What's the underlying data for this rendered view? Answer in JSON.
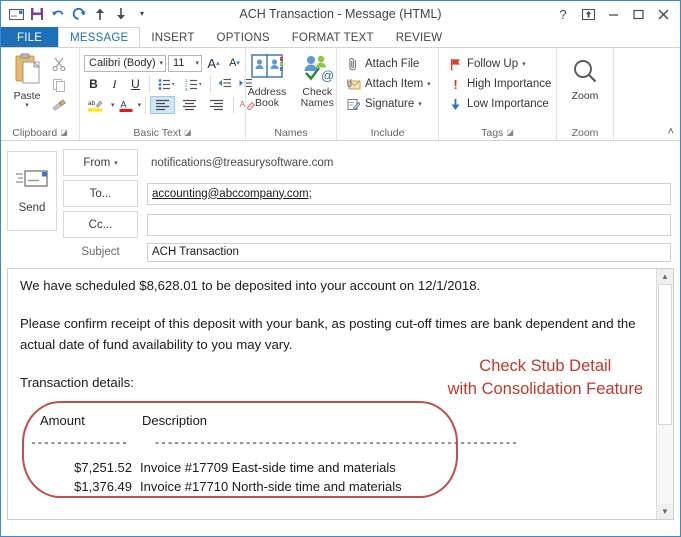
{
  "window": {
    "title": "ACH Transaction - Message (HTML)",
    "quick_access": [
      {
        "name": "envelope-icon",
        "glyph": "✉"
      },
      {
        "name": "save-icon",
        "glyph": "■"
      },
      {
        "name": "undo-icon",
        "glyph": "↶"
      },
      {
        "name": "redo-icon",
        "glyph": "↻"
      },
      {
        "name": "previous-item-icon",
        "glyph": "↑"
      },
      {
        "name": "next-item-icon",
        "glyph": "↓"
      },
      {
        "name": "customize-qat-icon",
        "glyph": "▾"
      }
    ],
    "controls": [
      {
        "name": "help-button",
        "glyph": "?"
      },
      {
        "name": "ribbon-display-options-button",
        "glyph": "⤒"
      },
      {
        "name": "minimize-button",
        "glyph": "—"
      },
      {
        "name": "maximize-button",
        "glyph": "□"
      },
      {
        "name": "close-button",
        "glyph": "✕"
      }
    ]
  },
  "ribbon": {
    "tabs": [
      {
        "label": "FILE",
        "state": "file"
      },
      {
        "label": "MESSAGE",
        "state": "active"
      },
      {
        "label": "INSERT",
        "state": "normal"
      },
      {
        "label": "OPTIONS",
        "state": "normal"
      },
      {
        "label": "FORMAT TEXT",
        "state": "normal"
      },
      {
        "label": "REVIEW",
        "state": "normal"
      }
    ],
    "groups": {
      "clipboard": {
        "label": "Clipboard",
        "paste_label": "Paste",
        "paste_caret": "▾",
        "cut_label": "Cut",
        "copy_label": "Copy",
        "format_painter_label": "Format Painter"
      },
      "basic_text": {
        "label": "Basic Text",
        "font_name": "Calibri (Body)",
        "font_size": "11",
        "caret": "▾",
        "grow_font": "A",
        "shrink_font": "A",
        "bold": "B",
        "italic": "I",
        "underline": "U",
        "bullets": "•≡",
        "numbering": "1≡",
        "decrease_indent": "⇤",
        "increase_indent": "⇥",
        "highlight": "ab",
        "font_color": "A",
        "align_left": "≡",
        "align_center": "≡",
        "align_right": "≡",
        "clear_formatting": "A"
      },
      "names": {
        "label": "Names",
        "address_book": "Address Book",
        "address_book_line1": "Address",
        "address_book_line2": "Book",
        "check_names_line1": "Check",
        "check_names_line2": "Names"
      },
      "include": {
        "label": "Include",
        "items": [
          {
            "label": "Attach File",
            "icon": "paperclip-icon",
            "glyph": "📎",
            "caret": ""
          },
          {
            "label": "Attach Item",
            "icon": "attach-item-icon",
            "glyph": "▤",
            "caret": "▾"
          },
          {
            "label": "Signature",
            "icon": "signature-icon",
            "glyph": "✎",
            "caret": "▾"
          }
        ]
      },
      "tags": {
        "label": "Tags",
        "items": [
          {
            "label": "Follow Up",
            "icon": "flag-icon",
            "glyph": "⚑",
            "color": "#d83b2a",
            "caret": "▾"
          },
          {
            "label": "High Importance",
            "icon": "exclamation-icon",
            "glyph": "!",
            "color": "#d83b2a",
            "caret": ""
          },
          {
            "label": "Low Importance",
            "icon": "down-arrow-icon",
            "glyph": "↓",
            "color": "#2f6fc0",
            "caret": ""
          }
        ]
      },
      "zoom": {
        "label": "Zoom",
        "button_label": "Zoom",
        "icon": "magnifier-icon"
      }
    },
    "collapse_glyph": "˄"
  },
  "message": {
    "send_label": "Send",
    "from_label": "From",
    "from_caret": "▾",
    "from_value": "notifications@treasurysoftware.com",
    "to_label": "To...",
    "to_value": "accounting@abccompany.com;",
    "cc_label": "Cc...",
    "cc_value": "",
    "subject_label": "Subject",
    "subject_value": "ACH Transaction"
  },
  "body": {
    "paragraph1": "We have scheduled $8,628.01 to be deposited into your account on 12/1/2018.",
    "paragraph2": "Please confirm receipt of this deposit with your bank, as posting cut-off times are bank dependent and the actual date of fund availability to you may vary.",
    "paragraph3": "Transaction details:",
    "table": {
      "headers": [
        "Amount",
        "Description"
      ],
      "separator_amount": "---------------",
      "separator_description": "--------------------------------------------------------",
      "rows": [
        {
          "amount": "$7,251.52",
          "description": "Invoice #17709  East-side time and materials"
        },
        {
          "amount": "$1,376.49",
          "description": "Invoice #17710  North-side time and materials"
        }
      ]
    }
  },
  "annotation": {
    "line1": "Check Stub Detail",
    "line2": "with Consolidation Feature",
    "color": "#c0392b"
  },
  "scrollbar": {
    "up_glyph": "▲",
    "down_glyph": "▼"
  }
}
